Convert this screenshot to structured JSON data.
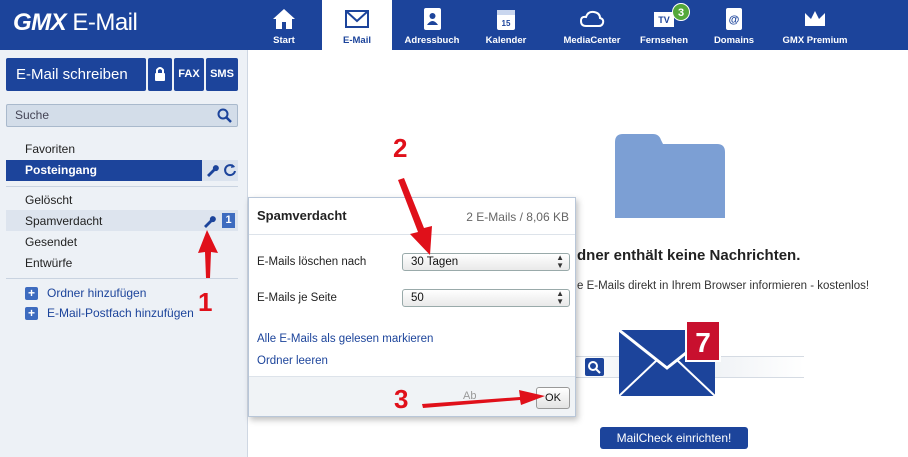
{
  "header": {
    "brand_bold": "GMX",
    "brand_rest": " E-Mail",
    "nav": [
      {
        "label": "Start"
      },
      {
        "label": "E-Mail"
      },
      {
        "label": "Adressbuch"
      },
      {
        "label": "Kalender"
      },
      {
        "label": "MediaCenter"
      },
      {
        "label": "Fernsehen"
      },
      {
        "label": "Domains"
      },
      {
        "label": "GMX Premium"
      }
    ],
    "tv_badge": "3",
    "calendar_day": "15",
    "tv_icon_text": "TV"
  },
  "sidebar": {
    "write_label": "E-Mail schreiben",
    "fax_label": "FAX",
    "sms_label": "SMS",
    "search_placeholder": "Suche",
    "favorites": "Favoriten",
    "inbox": "Posteingang",
    "folders": [
      "Gelöscht",
      "Spamverdacht",
      "Gesendet",
      "Entwürfe"
    ],
    "spam_count": "1",
    "add_folder": "Ordner hinzufügen",
    "add_mailbox": "E-Mail-Postfach hinzufügen"
  },
  "popup": {
    "title": "Spamverdacht",
    "info": "2 E-Mails / 8,06 KB",
    "delete_label": "E-Mails löschen nach",
    "delete_value": "30 Tagen",
    "perpage_label": "E-Mails je Seite",
    "perpage_value": "50",
    "mark_read": "Alle E-Mails als gelesen markieren",
    "empty_folder": "Ordner leeren",
    "cancel_label": "Ab",
    "ok_label": "OK"
  },
  "main": {
    "empty_title": "dner enthält keine Nachrichten.",
    "promo_text": "e E-Mails direkt in Ihrem Browser informieren - kostenlos!",
    "mailcheck_count": "7",
    "mailcheck_button": "MailCheck einrichten!"
  },
  "annotations": [
    "1",
    "2",
    "3"
  ],
  "colors": {
    "brand_blue": "#1c449b",
    "annotation_red": "#e0101a"
  }
}
